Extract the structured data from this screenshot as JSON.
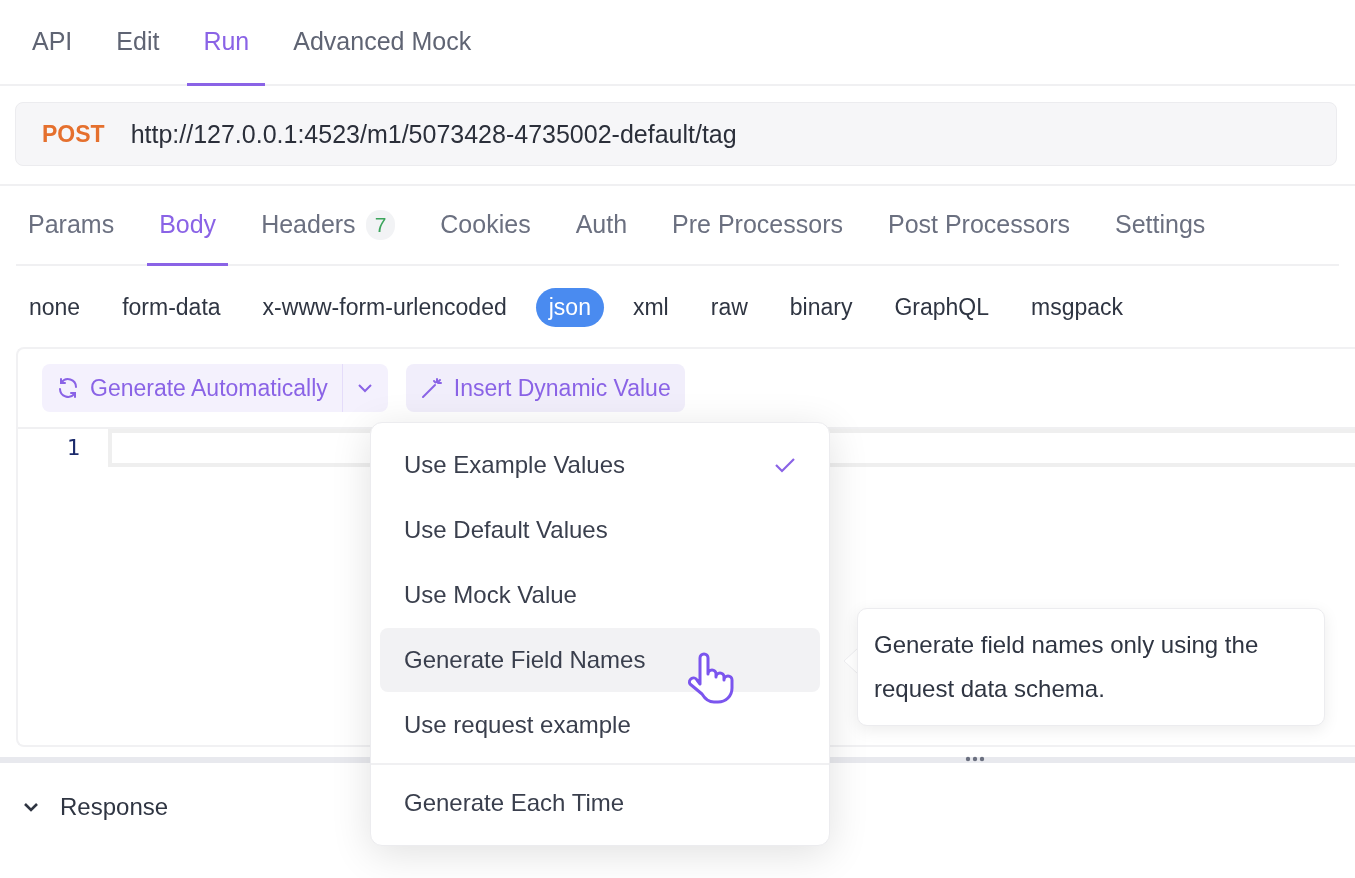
{
  "top_tabs": [
    {
      "label": "API",
      "selected": false
    },
    {
      "label": "Edit",
      "selected": false
    },
    {
      "label": "Run",
      "selected": true
    },
    {
      "label": "Advanced Mock",
      "selected": false
    }
  ],
  "request": {
    "method": "POST",
    "url": "http://127.0.0.1:4523/m1/5073428-4735002-default/tag"
  },
  "request_tabs": [
    {
      "label": "Params",
      "selected": false
    },
    {
      "label": "Body",
      "selected": true
    },
    {
      "label": "Headers",
      "count": "7",
      "selected": false
    },
    {
      "label": "Cookies",
      "selected": false
    },
    {
      "label": "Auth",
      "selected": false
    },
    {
      "label": "Pre Processors",
      "selected": false
    },
    {
      "label": "Post Processors",
      "selected": false
    },
    {
      "label": "Settings",
      "selected": false
    }
  ],
  "body_types": [
    {
      "label": "none",
      "selected": false
    },
    {
      "label": "form-data",
      "selected": false
    },
    {
      "label": "x-www-form-urlencoded",
      "selected": false
    },
    {
      "label": "json",
      "selected": true
    },
    {
      "label": "xml",
      "selected": false
    },
    {
      "label": "raw",
      "selected": false
    },
    {
      "label": "binary",
      "selected": false
    },
    {
      "label": "GraphQL",
      "selected": false
    },
    {
      "label": "msgpack",
      "selected": false
    }
  ],
  "toolbar": {
    "generate_button": "Generate Automatically",
    "insert_button": "Insert Dynamic Value"
  },
  "editor": {
    "line_numbers": [
      "1"
    ]
  },
  "response": {
    "label": "Response",
    "expanded": false
  },
  "menu": {
    "groups": [
      [
        {
          "label": "Use Example Values",
          "checked": true,
          "hovered": false
        },
        {
          "label": "Use Default Values",
          "checked": false,
          "hovered": false
        },
        {
          "label": "Use Mock Value",
          "checked": false,
          "hovered": false
        },
        {
          "label": "Generate Field Names",
          "checked": false,
          "hovered": true
        },
        {
          "label": "Use request example",
          "checked": false,
          "hovered": false
        }
      ],
      [
        {
          "label": "Generate Each Time",
          "checked": false,
          "hovered": false
        }
      ]
    ]
  },
  "tooltip": {
    "text": "Generate field names only using the request data schema."
  }
}
